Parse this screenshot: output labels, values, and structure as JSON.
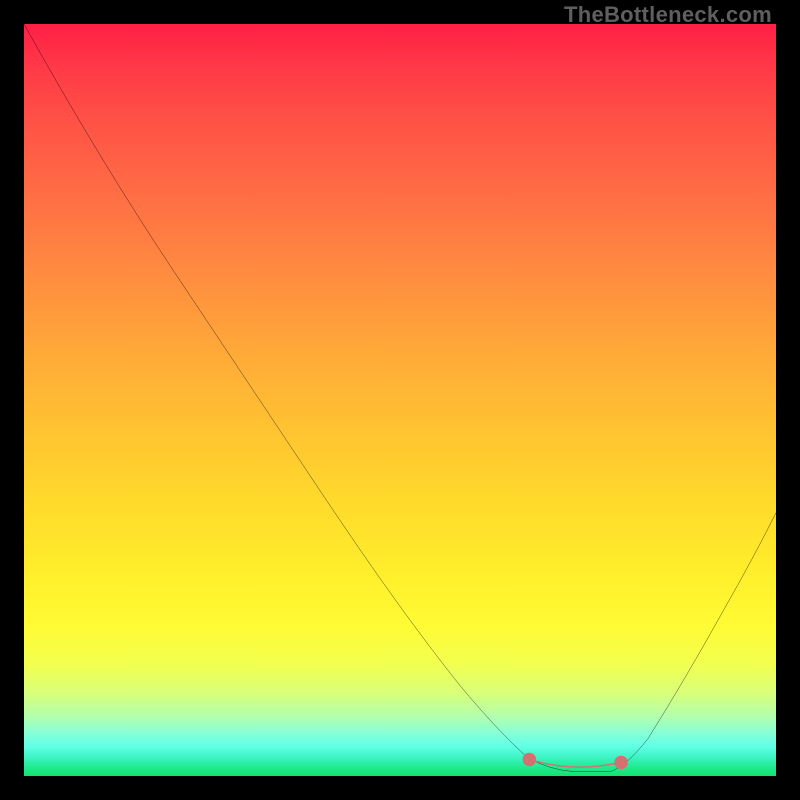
{
  "watermark": "TheBottleneck.com",
  "colors": {
    "page_bg": "#000000",
    "curve": "#000000",
    "marker": "#d66f6f",
    "gradient_top": "#ff1f46",
    "gradient_bottom": "#13e36e"
  },
  "chart_data": {
    "type": "line",
    "title": "",
    "xlabel": "",
    "ylabel": "",
    "xlim": [
      0,
      100
    ],
    "ylim": [
      0,
      100
    ],
    "grid": false,
    "legend": false,
    "series": [
      {
        "name": "bottleneck-curve",
        "x": [
          0,
          5,
          10,
          15,
          20,
          25,
          30,
          35,
          40,
          45,
          50,
          55,
          60,
          65,
          70,
          75,
          78,
          80,
          85,
          90,
          95,
          100
        ],
        "values": [
          100,
          92,
          84,
          76,
          68,
          60,
          52,
          44,
          36,
          29,
          22,
          16,
          10,
          5,
          2,
          0.5,
          0.5,
          2,
          8,
          16,
          25,
          35
        ]
      }
    ],
    "annotations": [
      {
        "name": "optimal-range-marker",
        "x_start": 68,
        "x_end": 80,
        "y": 0.8,
        "color": "#d66f6f"
      }
    ]
  }
}
